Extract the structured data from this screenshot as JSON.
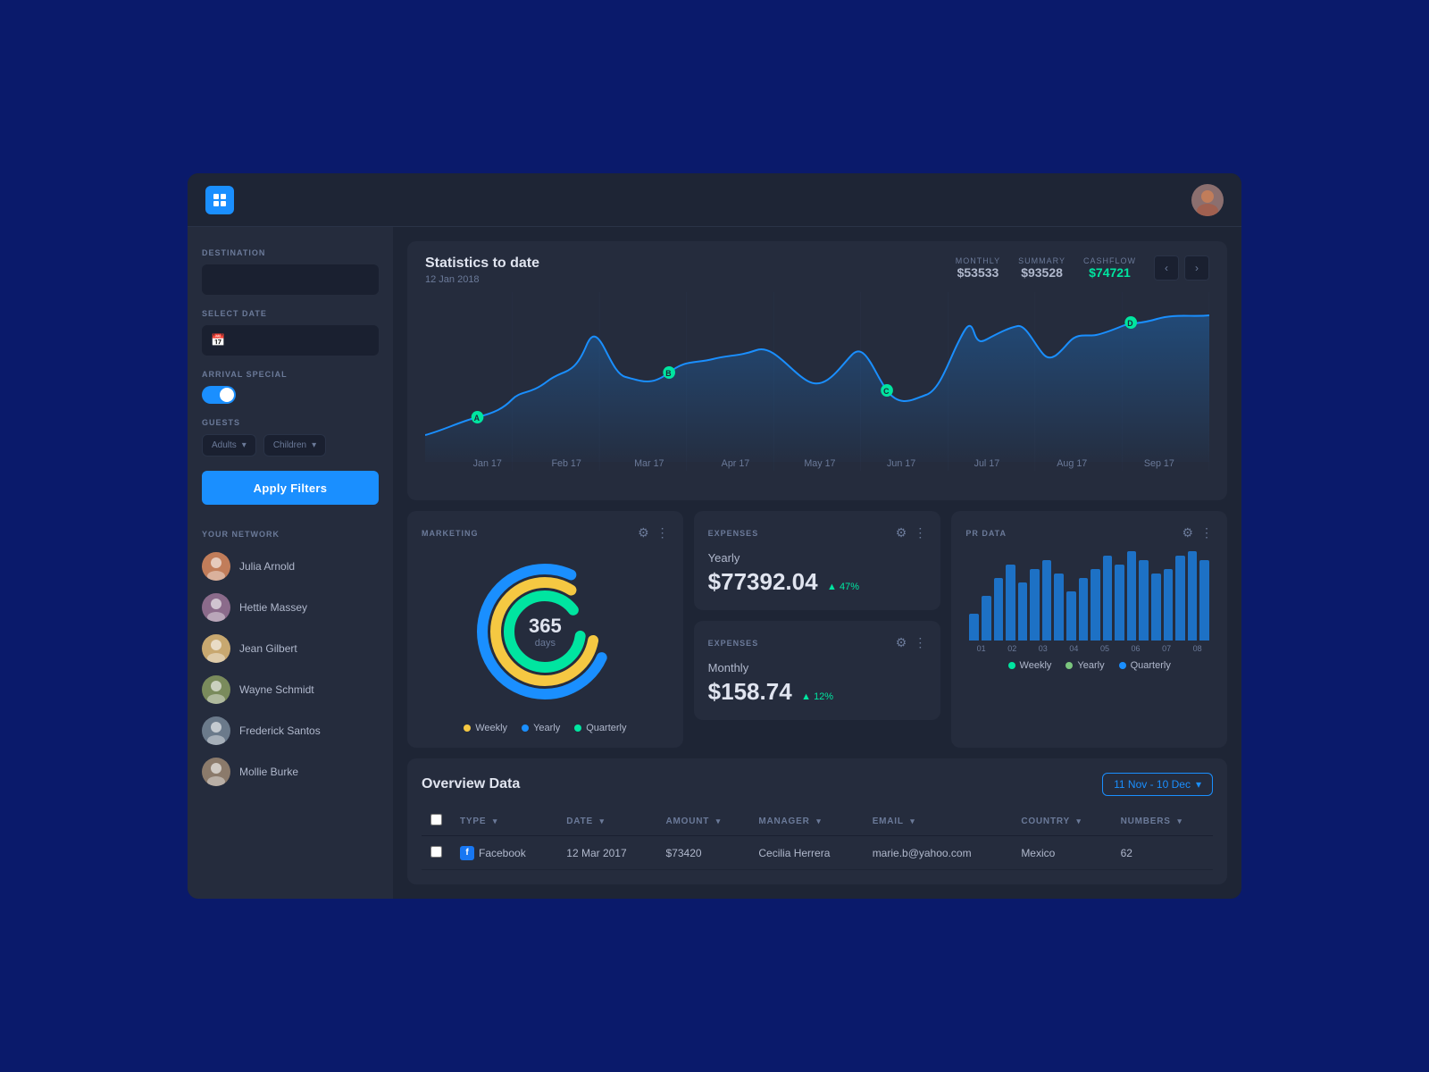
{
  "app": {
    "logo_label": "App Logo",
    "user_initial": "👤"
  },
  "sidebar": {
    "destination_label": "DESTINATION",
    "destination_placeholder": "",
    "select_date_label": "SELECT DATE",
    "date_placeholder": "",
    "arrival_special_label": "ARRIVAL SPECIAL",
    "guests_label": "GUESTS",
    "adults_option": "Adults",
    "children_option": "Children",
    "apply_filters_label": "Apply Filters",
    "network_label": "YOUR NETWORK",
    "network_people": [
      {
        "name": "Julia Arnold",
        "color": "#c17d5a"
      },
      {
        "name": "Hettie Massey",
        "color": "#8b6b8b"
      },
      {
        "name": "Jean Gilbert",
        "color": "#c8a870"
      },
      {
        "name": "Wayne Schmidt",
        "color": "#7a8b5c"
      },
      {
        "name": "Frederick Santos",
        "color": "#6b7a8b"
      },
      {
        "name": "Mollie Burke",
        "color": "#8b7a6b"
      }
    ]
  },
  "stats": {
    "title": "Statistics to date",
    "date": "12 Jan 2018",
    "monthly_label": "MONTHLY",
    "monthly_value": "$53533",
    "summary_label": "SUMMARY",
    "summary_value": "$93528",
    "cashflow_label": "CASHFLOW",
    "cashflow_value": "$74721",
    "months": [
      "Jan 17",
      "Feb 17",
      "Mar 17",
      "Apr 17",
      "May 17",
      "Jun 17",
      "Jul 17",
      "Aug 17",
      "Sep 17"
    ]
  },
  "marketing": {
    "title": "MARKETING",
    "center_num": "365",
    "center_label": "days",
    "legend": [
      {
        "label": "Weekly",
        "color": "#f5c842"
      },
      {
        "label": "Yearly",
        "color": "#1a8fff"
      },
      {
        "label": "Quarterly",
        "color": "#00e5a0"
      }
    ]
  },
  "expenses_yearly": {
    "title": "EXPENSES",
    "label": "Yearly",
    "amount": "$77392.04",
    "change": "47%",
    "change_up": true
  },
  "expenses_monthly": {
    "title": "EXPENSES",
    "label": "Monthly",
    "amount": "$158.74",
    "change": "12%",
    "change_up": true
  },
  "pr_data": {
    "title": "PR DATA",
    "legend": [
      {
        "label": "Weekly",
        "color": "#00e5a0"
      },
      {
        "label": "Yearly",
        "color": "#7bc67e"
      },
      {
        "label": "Quarterly",
        "color": "#1a8fff"
      }
    ],
    "bar_labels": [
      "01",
      "02",
      "03",
      "04",
      "05",
      "06",
      "07",
      "08"
    ],
    "bars": [
      30,
      50,
      70,
      85,
      65,
      80,
      90,
      75,
      55,
      70,
      80,
      95,
      85,
      100,
      90,
      75,
      80,
      95,
      100,
      90
    ]
  },
  "overview": {
    "title": "Overview Data",
    "date_range": "11 Nov - 10 Dec",
    "columns": [
      "TYPE",
      "DATE",
      "AMOUNT",
      "MANAGER",
      "EMAIL",
      "COUNTRY",
      "NUMBERS"
    ],
    "row": {
      "type": "Facebook",
      "date": "12 Mar 2017",
      "amount": "$73420",
      "manager": "Cecilia Herrera",
      "email": "marie.b@yahoo.com",
      "country": "Mexico",
      "numbers": "62"
    }
  }
}
